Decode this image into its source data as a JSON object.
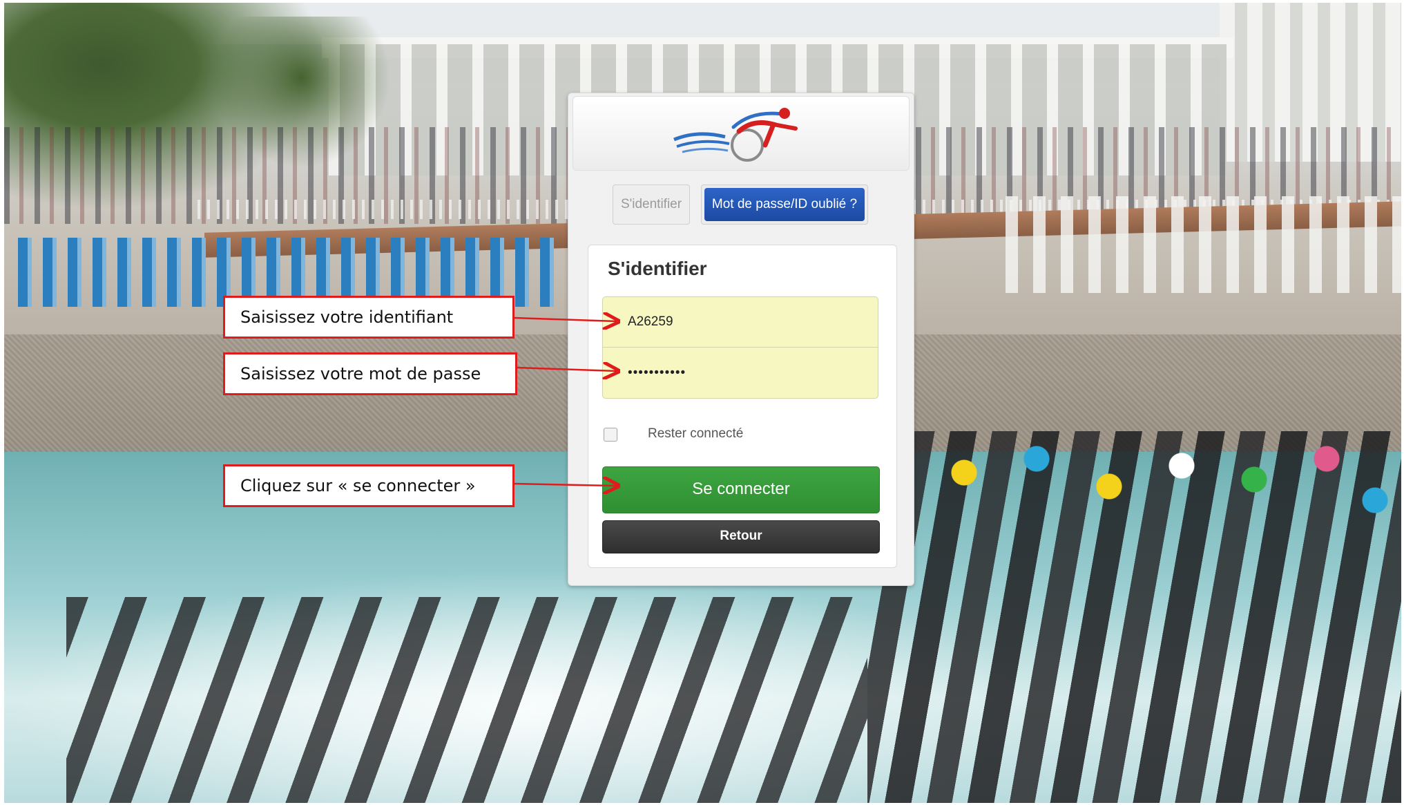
{
  "login_panel": {
    "logo": "triathlon-logo",
    "tabs": {
      "login": "S'identifier",
      "forgot": "Mot de passe/ID oublié ?"
    },
    "form_title": "S'identifier",
    "identifier_value": "A26259",
    "password_value": "•••••••••••",
    "remember_label": "Rester connecté",
    "remember_checked": false,
    "connect_button": "Se connecter",
    "back_button": "Retour"
  },
  "annotations": {
    "identifier_hint": "Saisissez votre identifiant",
    "password_hint": "Saisissez votre mot de passe",
    "connect_hint": "Cliquez sur « se connecter »"
  },
  "colors": {
    "accent_blue": "#1c4aa3",
    "connect_green": "#3ea541",
    "input_yellow": "#f7f7c2",
    "callout_red": "#e01b1b"
  }
}
